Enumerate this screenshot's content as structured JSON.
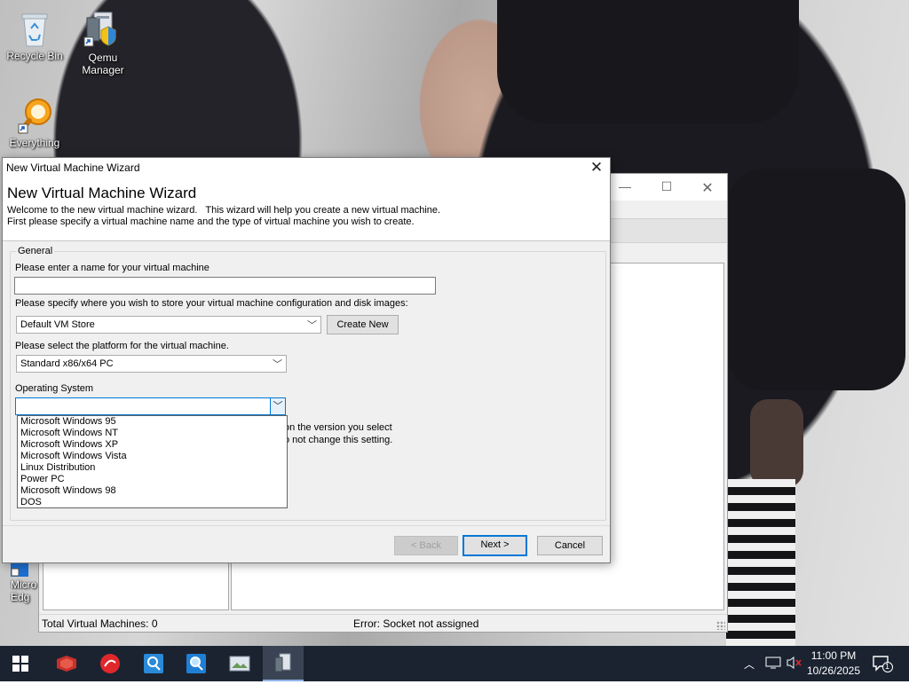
{
  "desktop": {
    "icons": [
      {
        "label": "Recycle Bin"
      },
      {
        "label": "Qemu\nManager"
      },
      {
        "label": "Everything"
      },
      {
        "label": "Micro\nEdg"
      }
    ]
  },
  "background_window": {
    "status_left": "Total Virtual Machines: 0",
    "status_right": "Error: Socket not assigned"
  },
  "wizard": {
    "window_title": "New Virtual Machine Wizard",
    "heading": "New Virtual Machine Wizard",
    "intro_line1": "Welcome to the new virtual machine wizard.   This wizard will help you create a new virtual machine.",
    "intro_line2": "First please specify a virtual machine name and the type of virtual machine you wish to create.",
    "group_label": "General",
    "name_label": "Please enter a name for your virtual machine",
    "name_value": "",
    "store_label": "Please specify where you wish to store your virtual machine configuration and disk images:",
    "store_value": "Default VM Store",
    "create_new_label": "Create New",
    "platform_label": "Please select the platform for the virtual machine.",
    "platform_value": "Standard x86/x64 PC",
    "os_label": "Operating System",
    "os_value": "",
    "os_options": [
      "Microsoft Windows 95",
      "Microsoft Windows NT",
      "Microsoft Windows XP",
      "Microsoft Windows Vista",
      "Linux Distribution",
      "Power PC",
      "Microsoft Windows 98",
      "DOS"
    ],
    "hidden_note_line1": "on the version you select",
    "hidden_note_line2": "o not change this setting.",
    "back_label": "< Back",
    "next_label": "Next >",
    "cancel_label": "Cancel"
  },
  "taskbar": {
    "apps": [
      "start-icon",
      "app-red-icon",
      "anydesk-icon",
      "everything-search-icon",
      "everything-search-icon-2",
      "photos-icon",
      "qemu-manager-icon"
    ],
    "time": "11:00 PM",
    "date": "10/26/2025",
    "notification_count": "1"
  },
  "colors": {
    "accent": "#0078d7",
    "taskbar": "#1b2331"
  }
}
